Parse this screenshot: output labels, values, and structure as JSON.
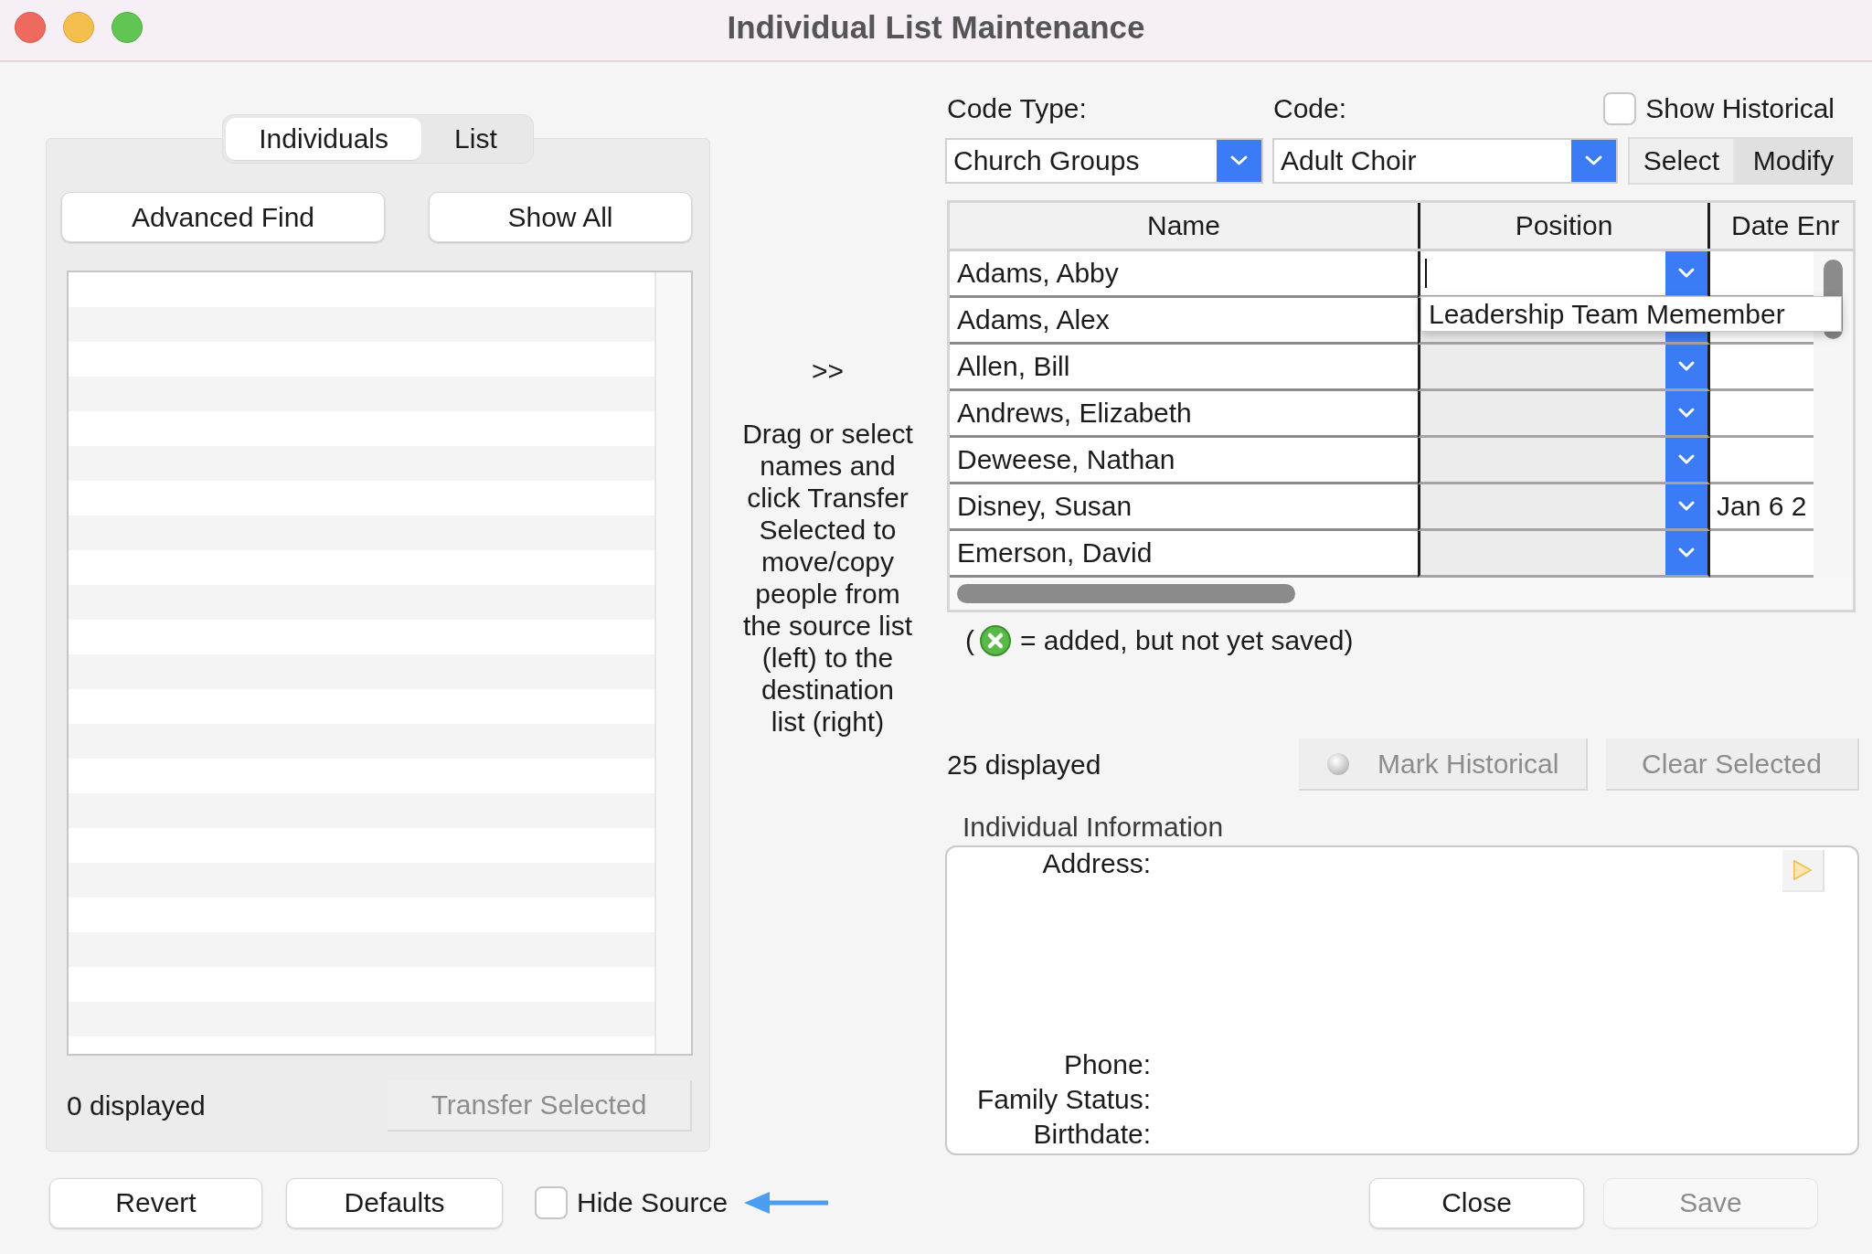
{
  "window": {
    "title": "Individual List Maintenance"
  },
  "source_panel": {
    "tabs": [
      {
        "label": "Individuals",
        "selected": true
      },
      {
        "label": "List",
        "selected": false
      }
    ],
    "buttons": [
      "Advanced Find",
      "Show All"
    ],
    "count": "0 displayed",
    "transfer_button": {
      "label": "Transfer Selected",
      "disabled": true
    }
  },
  "transfer_hint": {
    "arrow": ">>",
    "text": "Drag or select names and click Transfer Selected to move/copy people from the source list (left) to the destination list (right)"
  },
  "destination": {
    "code_type": {
      "label": "Code Type:",
      "value": "Church Groups"
    },
    "code": {
      "label": "Code:",
      "value": "Adult Choir"
    },
    "show_historical": {
      "label": "Show Historical",
      "checked": false
    },
    "mode_buttons": [
      {
        "label": "Select",
        "selected": false
      },
      {
        "label": "Modify",
        "selected": true
      }
    ],
    "table": {
      "columns": [
        "Name",
        "Position",
        "Date Enr"
      ],
      "rows": [
        {
          "name": "Adams, Abby",
          "editing": true,
          "menu": [
            "Leadership Team Memember"
          ]
        },
        {
          "name": "Adams, Alex",
          "editing": false
        },
        {
          "name": "Allen, Bill",
          "editing": false
        },
        {
          "name": "Andrews, Elizabeth",
          "editing": false
        },
        {
          "name": "Deweese, Nathan",
          "editing": false
        },
        {
          "name": "Disney, Susan",
          "editing": false,
          "date_enrolled": "Jan 6 2"
        },
        {
          "name": "Emerson, David",
          "editing": false
        }
      ]
    },
    "legend": {
      "open": "(",
      "text": "= added, but not yet saved)"
    },
    "count": "25 displayed",
    "mark_historical_button": {
      "label": "Mark Historical",
      "disabled": true
    },
    "clear_selected_button": {
      "label": "Clear Selected",
      "disabled": true
    }
  },
  "individual_information": {
    "title": "Individual Information",
    "fields": [
      {
        "label": "Address:",
        "kind": "multiline"
      },
      {
        "label": "Phone:",
        "kind": "line"
      },
      {
        "label": "Family Status:",
        "kind": "line"
      },
      {
        "label": "Birthdate:",
        "kind": "line"
      }
    ]
  },
  "footer": {
    "left_buttons": [
      "Revert",
      "Defaults"
    ],
    "hide_source": {
      "label": "Hide Source",
      "checked": false
    },
    "right_buttons": [
      {
        "label": "Close",
        "disabled": false
      },
      {
        "label": "Save",
        "disabled": true
      }
    ]
  }
}
